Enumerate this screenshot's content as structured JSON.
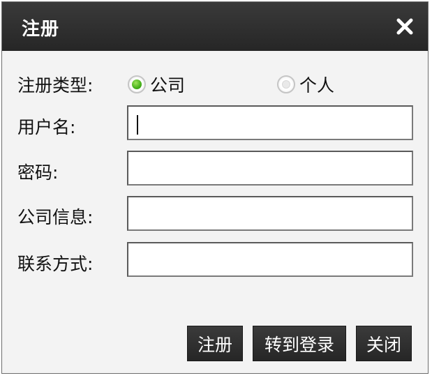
{
  "dialog": {
    "title": "注册"
  },
  "form": {
    "type_label": "注册类型:",
    "type_options": [
      "公司",
      "个人"
    ],
    "selected_type": "公司",
    "username_label": "用户名:",
    "password_label": "密码:",
    "company_info_label": "公司信息:",
    "contact_label": "联系方式:",
    "username_value": "",
    "password_value": "",
    "company_info_value": "",
    "contact_value": ""
  },
  "buttons": {
    "register": "注册",
    "to_login": "转到登录",
    "close": "关闭"
  },
  "icons": {
    "close": "close-icon"
  }
}
